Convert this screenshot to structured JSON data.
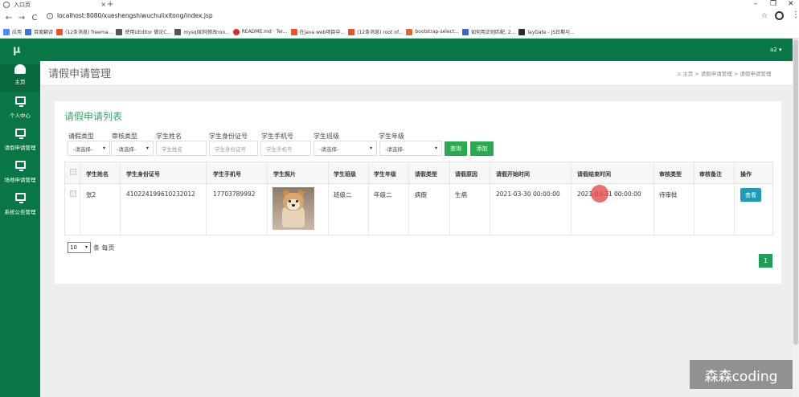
{
  "browser": {
    "tab_title": "入口页",
    "tab_close": "×",
    "new_tab": "+",
    "window_controls": [
      "–",
      "❐",
      "✕"
    ],
    "nav_buttons": [
      "←",
      "→",
      "C"
    ],
    "url": "localhost:8080/xueshengshiwuchulixitong/index.jsp",
    "bookmarks": [
      {
        "label": "应用",
        "color": "#4a8af4"
      },
      {
        "label": "百度翻译",
        "color": "#3b74e0"
      },
      {
        "label": "(12条消息) freema...",
        "color": "#e5542b"
      },
      {
        "label": "使用UEditor 做论C...",
        "color": "#555555"
      },
      {
        "label": "mysql如何修改roo...",
        "color": "#555555"
      },
      {
        "label": "README.md · Ter...",
        "color": "#d33030"
      },
      {
        "label": "在java web项目中...",
        "color": "#e5542b"
      },
      {
        "label": "(12条消息) root of...",
        "color": "#e5542b"
      },
      {
        "label": "bootstrap-select...",
        "color": "#d86a3a"
      },
      {
        "label": "如何用正则匹配, 2...",
        "color": "#3a66c9"
      },
      {
        "label": "layDate - JS日期与...",
        "color": "#2d2d2d"
      }
    ]
  },
  "app": {
    "logo": "μ",
    "user_menu": "a2 ▾",
    "sidebar": [
      {
        "label": "主页",
        "icon": "dashboard-icon"
      },
      {
        "label": "个人中心",
        "icon": "monitor-icon"
      },
      {
        "label": "请假申请管理",
        "icon": "monitor-icon"
      },
      {
        "label": "场地申请管理",
        "icon": "monitor-icon"
      },
      {
        "label": "系统公告管理",
        "icon": "monitor-icon"
      }
    ],
    "page_title": "请假申请管理",
    "breadcrumb": "⌂ 主页  >  请假申请管理  >  请假申请管理",
    "card_title": "请假申请列表",
    "filters": [
      {
        "label": "请假类型",
        "value": "-请选择-",
        "type": "select"
      },
      {
        "label": "审核类型",
        "value": "-请选择-",
        "type": "select"
      },
      {
        "label": "学生姓名",
        "placeholder": "学生姓名",
        "type": "input"
      },
      {
        "label": "学生身份证号",
        "placeholder": "学生身份证号",
        "type": "input"
      },
      {
        "label": "学生手机号",
        "placeholder": "学生手机号",
        "type": "input"
      },
      {
        "label": "学生班级",
        "value": "-请选择-",
        "type": "select"
      },
      {
        "label": "学生年级",
        "value": "-请选择-",
        "type": "select"
      }
    ],
    "query_button": "查询",
    "add_button": "添加",
    "table": {
      "headers": [
        "学生姓名",
        "学生身份证号",
        "学生手机号",
        "学生照片",
        "学生班级",
        "学生年级",
        "请假类型",
        "请假原因",
        "请假开始时间",
        "请假结束时间",
        "审核类型",
        "审核备注",
        "操作"
      ],
      "rows": [
        {
          "name": "张2",
          "id_card": "410224199610232012",
          "phone": "17703789992",
          "class": "班级二",
          "grade": "年级二",
          "leave_type": "病假",
          "reason": "生病",
          "start": "2021-03-30 00:00:00",
          "end": "2021-03-31 00:00:00",
          "review_type": "待审批",
          "review_note": "",
          "action": "查看"
        }
      ]
    },
    "page_size": "10",
    "page_size_suffix": "条 每页",
    "current_page": "1"
  },
  "watermark": "森森coding"
}
